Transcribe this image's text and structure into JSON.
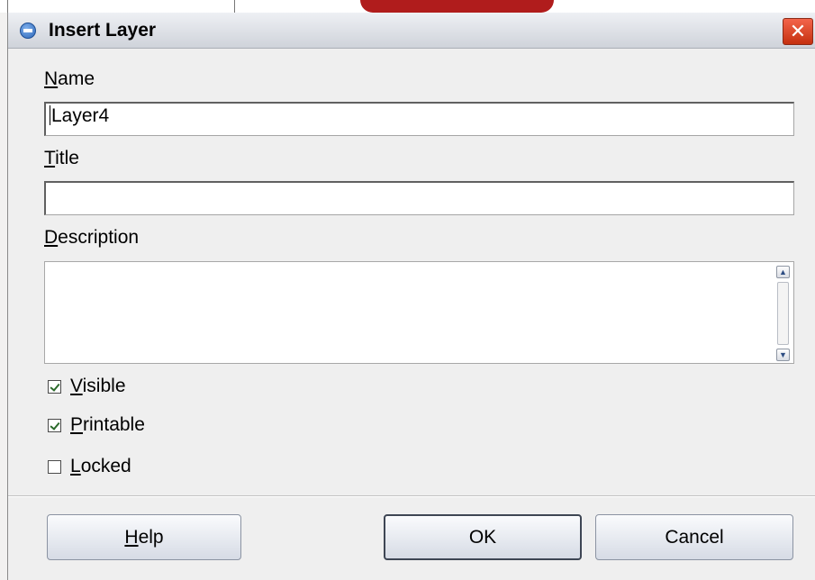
{
  "window": {
    "title": "Insert Layer",
    "close_glyph": "✕"
  },
  "form": {
    "name": {
      "label_accel": "N",
      "label_rest": "ame",
      "value": "Layer4"
    },
    "title": {
      "label_accel": "T",
      "label_rest": "itle",
      "value": ""
    },
    "description": {
      "label_accel": "D",
      "label_rest": "escription",
      "value": ""
    }
  },
  "options": {
    "visible": {
      "label_accel": "V",
      "label_rest": "isible",
      "checked": true
    },
    "printable": {
      "label_accel": "P",
      "label_rest": "rintable",
      "checked": true
    },
    "locked": {
      "label_accel": "L",
      "label_rest": "ocked",
      "checked": false
    }
  },
  "buttons": {
    "help": {
      "label_accel": "H",
      "label_rest": "elp"
    },
    "ok": {
      "label": "OK"
    },
    "cancel": {
      "label": "Cancel"
    }
  },
  "icons": {
    "app": "app-icon",
    "close": "close-icon",
    "scroll_up": "scroll-up-icon",
    "scroll_down": "scroll-down-icon"
  }
}
